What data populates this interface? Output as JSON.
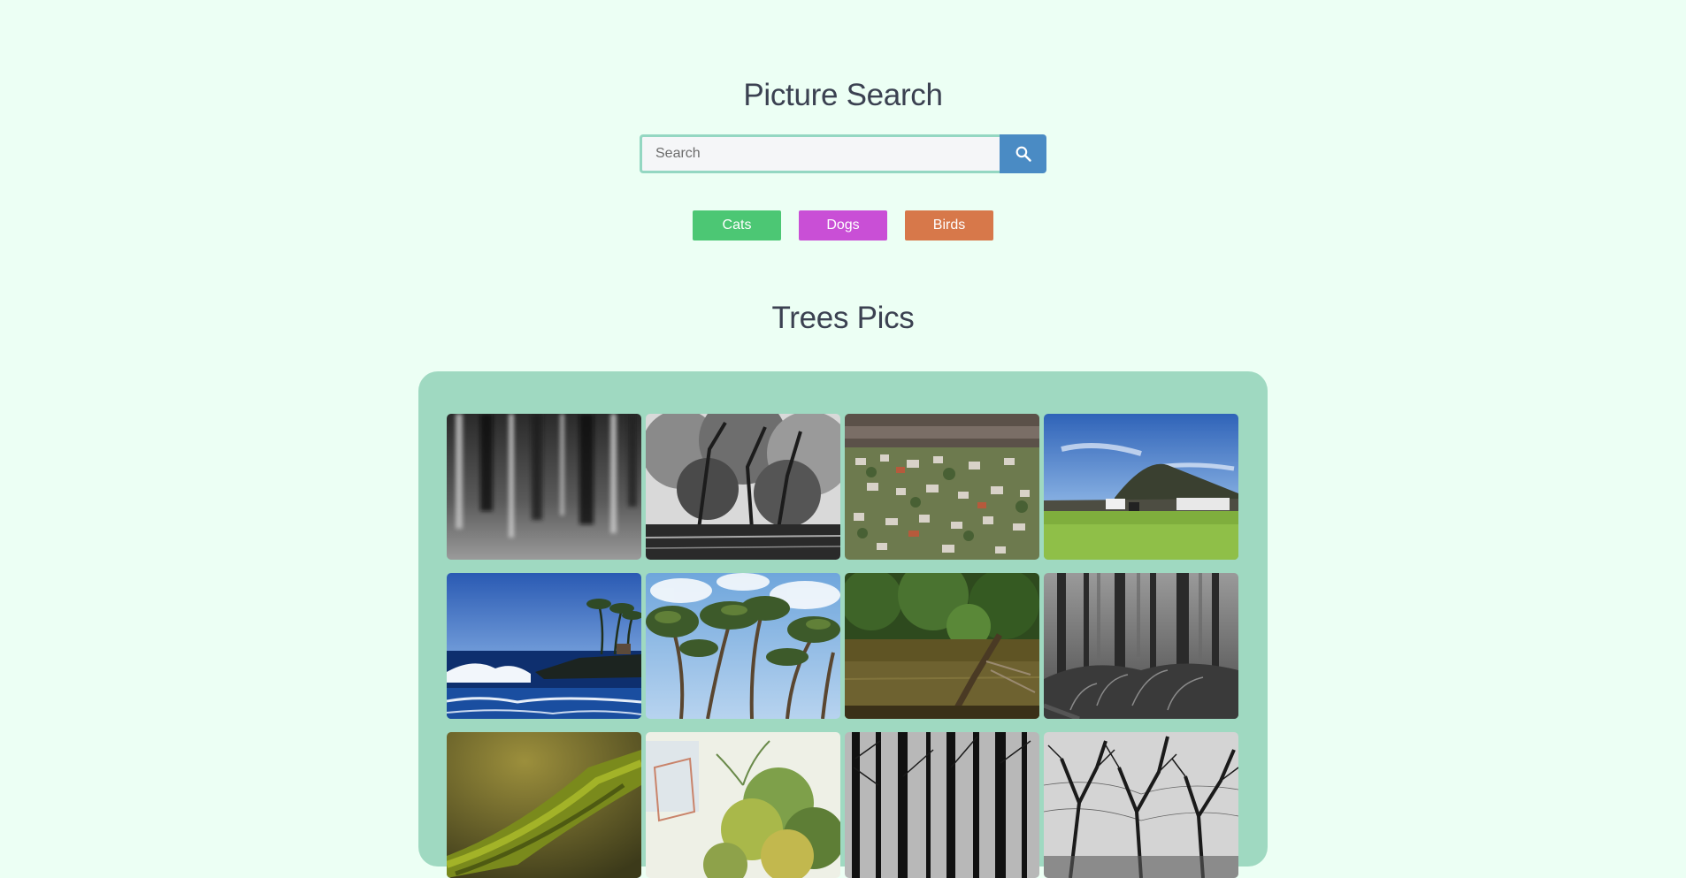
{
  "header": {
    "title": "Picture Search"
  },
  "search": {
    "placeholder": "Search",
    "value": "",
    "button_icon": "search-icon"
  },
  "categories": [
    {
      "label": "Cats",
      "color": "#4cc774"
    },
    {
      "label": "Dogs",
      "color": "#c94fd6"
    },
    {
      "label": "Birds",
      "color": "#d7784a"
    }
  ],
  "gallery": {
    "title": "Trees Pics",
    "background": "#9fd9c1",
    "images": [
      {
        "subject": "blurred black and white forest trunks"
      },
      {
        "subject": "black and white trees over water"
      },
      {
        "subject": "aerial view of small town with trees"
      },
      {
        "subject": "green lawn under blue sky with hill"
      },
      {
        "subject": "ocean waves and palm trees on rocky shore"
      },
      {
        "subject": "cypress trees against blue sky"
      },
      {
        "subject": "forest pond with leaning tree"
      },
      {
        "subject": "misty dark forest with ferns"
      },
      {
        "subject": "moss covered branch close-up"
      },
      {
        "subject": "watercolor style palm and foliage"
      },
      {
        "subject": "black and white bare tree trunks"
      },
      {
        "subject": "black and white bare tree canopy"
      }
    ]
  },
  "colors": {
    "page_background": "#ecfff4",
    "text": "#3b4151",
    "search_button": "#4a8bc4",
    "search_border": "#94d7c2"
  }
}
